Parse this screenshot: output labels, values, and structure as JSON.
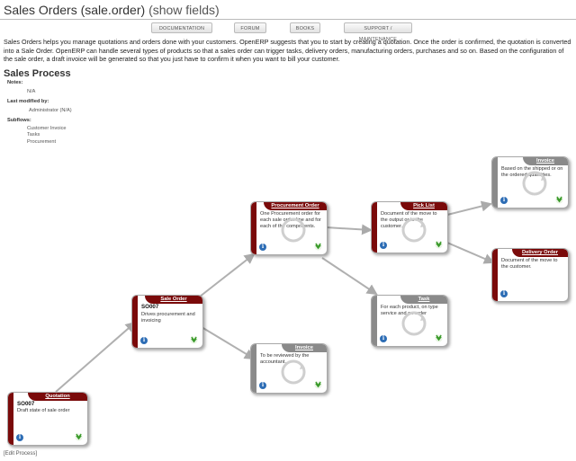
{
  "header": {
    "title": "Sales Orders (sale.order)",
    "show_fields": "(show fields)"
  },
  "toolbar": {
    "documentation": "DOCUMENTATION",
    "forum": "FORUM",
    "books": "BOOKS",
    "support": "SUPPORT / MAINTENANCE"
  },
  "intro": "Sales Orders helps you manage quotations and orders done with your customers. OpenERP suggests that you to start by creating a quotation. Once the order is confirmed, the quotation is converted into a Sale Order. OpenERP can handle several types of products so that a sales order can trigger tasks, delivery orders, manufacturing orders, purchases and so on. Based on the configuration of the sale order, a draft invoice will be generated so that you just have to confirm it when you want to bill your customer.",
  "process": {
    "title": "Sales Process",
    "notes_label": "Notes:",
    "notes_value": "N/A",
    "modified_label": "Last modified by:",
    "modified_value": "Administrator (N/A)",
    "subflows_label": "Subflows:",
    "subflows": [
      "Customer Invoice",
      "Tasks",
      "Procurement"
    ]
  },
  "nodes": {
    "quotation": {
      "title": "Quotation",
      "ref": "SO007",
      "desc": "Draft state of sale order"
    },
    "sale_order": {
      "title": "Sale Order",
      "ref": "SO007",
      "desc": "Drives procurement and invoicing"
    },
    "invoice_mid": {
      "title": "Invoice",
      "desc": "To be reviewed by the accountant."
    },
    "procurement": {
      "title": "Procurement Order",
      "desc": "One Procurement order for each sale order line and for each of the components."
    },
    "pick_list": {
      "title": "Pick List",
      "desc": "Document of the move to the output or to the customer."
    },
    "task": {
      "title": "Task",
      "desc": "For each product, on type service and on order"
    },
    "invoice_top": {
      "title": "Invoice",
      "desc": "Based on the shipped or on the ordered quantities."
    },
    "delivery": {
      "title": "Delivery Order",
      "desc": "Document of the move to the customer."
    }
  },
  "colors": {
    "active": "#7a0a0a",
    "inactive": "#8a8a8a",
    "info": "#2d6db5",
    "go": "#3a9a2a"
  },
  "footer": {
    "edit_process": "[Edit Process]"
  }
}
